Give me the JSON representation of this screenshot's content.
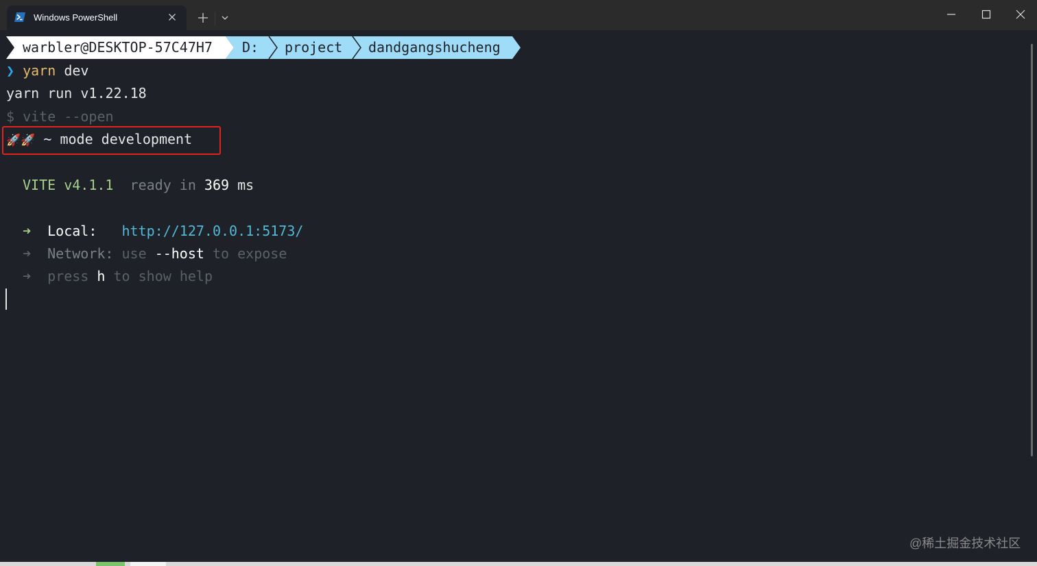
{
  "window": {
    "tab_title": "Windows PowerShell",
    "watermark": "@稀土掘金技术社区"
  },
  "prompt": {
    "user": "warbler@DESKTOP-57C47H7",
    "drive": "D:",
    "dir1": "project",
    "dir2": "dandgangshucheng"
  },
  "lines": {
    "cmd_arrow": "❯",
    "cmd": "yarn",
    "cmd_arg": "dev",
    "yarn_run": "yarn run v1.22.18",
    "vite_cmd": "$ vite --open",
    "mode_rockets": "🚀🚀",
    "mode_text": "~ mode development",
    "vite_name": "VITE v4.1.1",
    "ready_in": "ready in",
    "ready_ms": "369",
    "ready_unit": "ms",
    "local_arrow": "➜",
    "local_label": "Local:",
    "local_url": "http://127.0.0.1:5173/",
    "net_arrow": "➜",
    "net_label": "Network:",
    "net_use": "use",
    "net_host": "--host",
    "net_rest": "to expose",
    "help_arrow": "➜",
    "help_press": "press",
    "help_key": "h",
    "help_rest": "to show help"
  },
  "colors": {
    "background": "#1e2128",
    "titlebar": "#2b2b2b",
    "prompt_user_bg": "#ffffff",
    "prompt_path_bg": "#9fdcf7",
    "highlight_box": "#e0241f",
    "vite_green": "#a7d08c",
    "link": "#52b9d6"
  }
}
